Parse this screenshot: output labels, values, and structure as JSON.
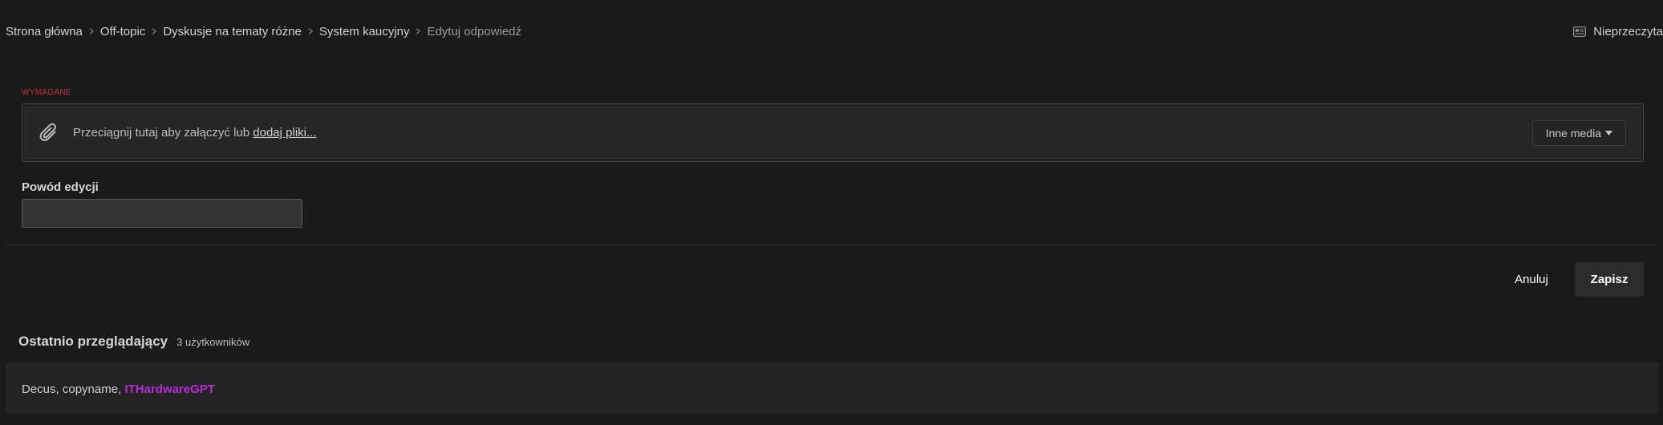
{
  "breadcrumb": {
    "items": [
      "Strona główna",
      "Off-topic",
      "Dyskusje na tematy różne",
      "System kaucyjny"
    ],
    "current": "Edytuj odpowiedź"
  },
  "header": {
    "unread_label": "Nieprzeczyta"
  },
  "attachments": {
    "required_label": "WYMAGANE",
    "drop_text": "Przeciągnij tutaj aby załączyć lub ",
    "add_files_link": "dodaj pliki...",
    "other_media_label": "Inne media"
  },
  "edit_reason": {
    "label": "Powód edycji",
    "value": ""
  },
  "actions": {
    "cancel_label": "Anuluj",
    "save_label": "Zapisz"
  },
  "recent_viewers": {
    "title": "Ostatnio przeglądający",
    "count": "3 użytkowników",
    "users": [
      "Decus",
      "copyname"
    ],
    "highlighted_user": "ITHardwareGPT",
    "highlight_color": "#b72cd9"
  }
}
